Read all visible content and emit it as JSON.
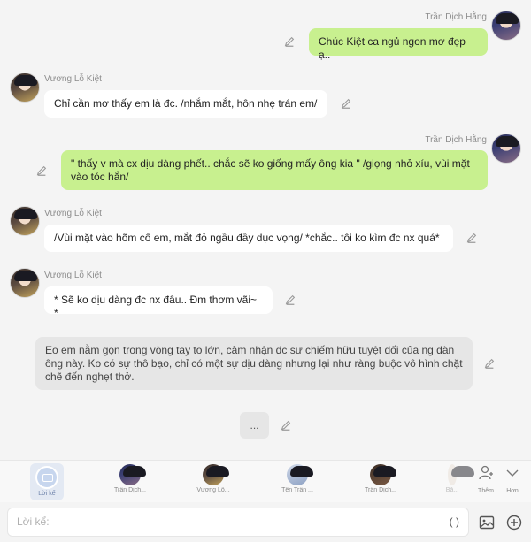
{
  "messages": [
    {
      "speaker": "Trần Dịch Hằng",
      "side": "right",
      "text": "Chúc Kiệt ca ngủ ngon mơ đẹp ạ.."
    },
    {
      "speaker": "Vương Lỗ Kiệt",
      "side": "left",
      "text": "Chỉ cần mơ thấy em là đc. /nhắm mắt, hôn nhẹ trán em/"
    },
    {
      "speaker": "Trần Dịch Hằng",
      "side": "right",
      "text": "\" thấy v mà cx dịu dàng phết.. chắc sẽ ko giống mấy ông kia \" /giọng nhỏ xíu, vùi mặt vào tóc hắn/"
    },
    {
      "speaker": "Vương Lỗ Kiệt",
      "side": "left",
      "text": "/Vùi mặt vào hõm cổ em, mắt đỏ ngầu đầy dục vọng/ *chắc.. tôi ko kìm đc nx quá*"
    },
    {
      "speaker": "Vương Lỗ Kiệt",
      "side": "left",
      "text": "* Sẽ ko dịu dàng đc nx đâu.. Đm thơm vãi~ *"
    }
  ],
  "narration": "Eo em nằm gọn trong vòng tay to lớn, cảm nhận đc sự chiếm hữu tuyệt đối của ng đàn ông này. Ko có sự thô bạo, chỉ có một sự dịu dàng nhưng lại như ràng buộc vô hình chặt chẽ đến nghẹt thở.",
  "typing_indicator": "...",
  "characters": [
    {
      "label": "Lời kể",
      "selected": true
    },
    {
      "label": "Trần Dịch..."
    },
    {
      "label": "Vương Lỗ..."
    },
    {
      "label": "Tên Trần ..."
    },
    {
      "label": "Trần Dịch..."
    },
    {
      "label": "Bă..."
    }
  ],
  "more_buttons": {
    "add_label": "Thêm",
    "more_label": "Hơn"
  },
  "input": {
    "placeholder": "Lời kể:",
    "paren_label": "( )"
  }
}
